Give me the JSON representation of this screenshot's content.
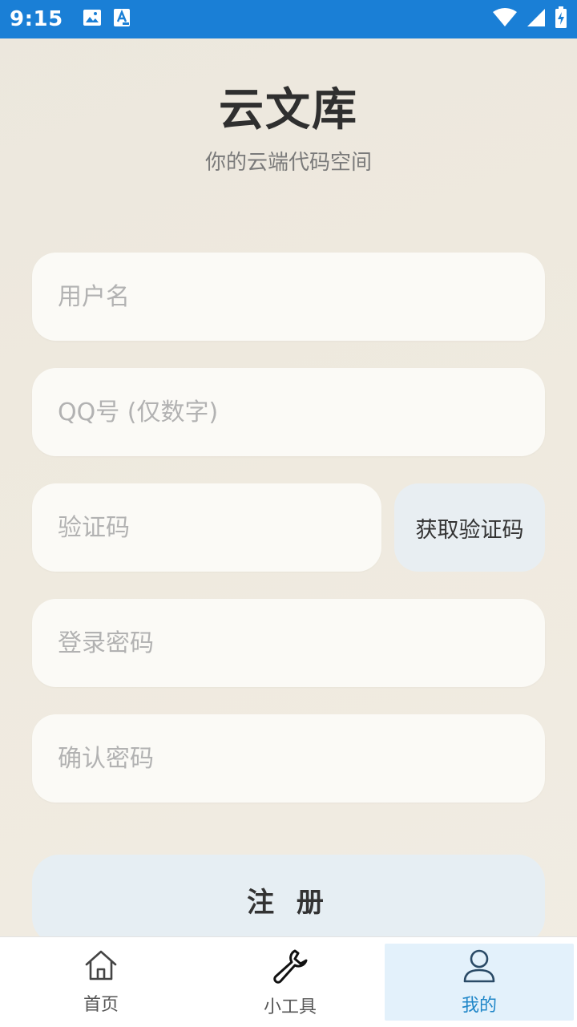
{
  "status_bar": {
    "time": "9:15",
    "left_icons": [
      "image-icon",
      "text-icon"
    ],
    "right_icons": [
      "wifi-icon",
      "signal-icon",
      "battery-charging-icon"
    ]
  },
  "header": {
    "title": "云文库",
    "subtitle": "你的云端代码空间"
  },
  "form": {
    "username_placeholder": "用户名",
    "qq_placeholder": "QQ号 (仅数字)",
    "code_placeholder": "验证码",
    "get_code_label": "获取验证码",
    "password_placeholder": "登录密码",
    "confirm_password_placeholder": "确认密码",
    "register_label": "注 册"
  },
  "nav": {
    "items": [
      {
        "label": "首页",
        "icon": "home-icon"
      },
      {
        "label": "小工具",
        "icon": "wrench-icon"
      },
      {
        "label": "我的",
        "icon": "user-icon",
        "active": true
      }
    ]
  },
  "colors": {
    "status_bar": "#1a7fd6",
    "accent": "#1f86c8",
    "active_tab_bg": "#e3f1fb"
  }
}
